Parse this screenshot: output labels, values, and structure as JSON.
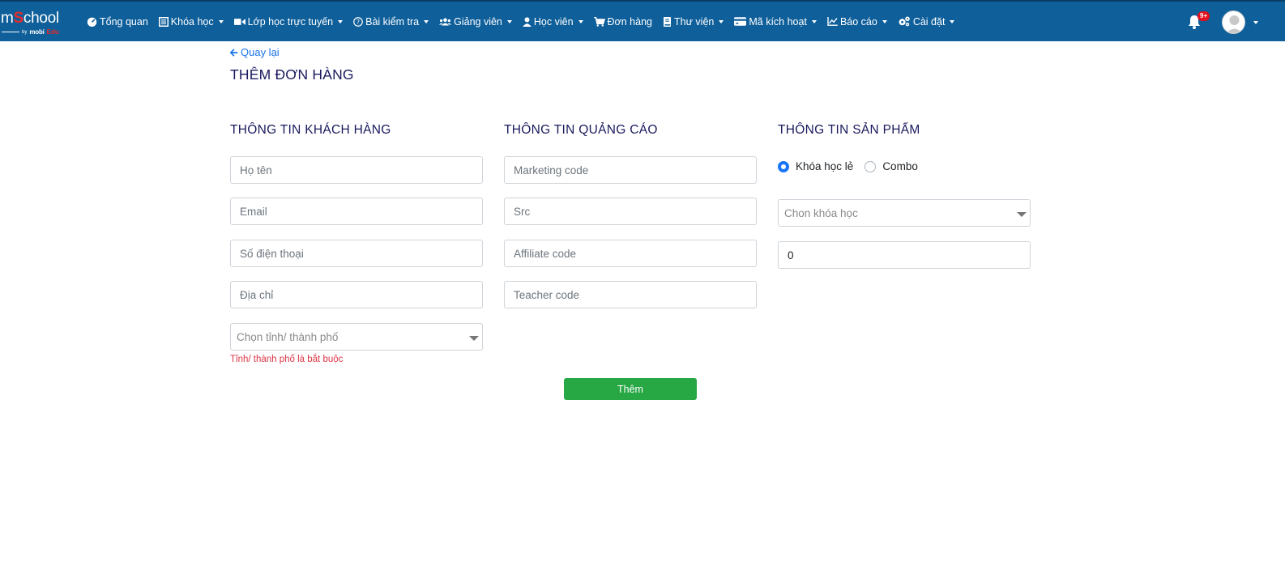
{
  "brand": {
    "name_part1": "m",
    "name_part2": "S",
    "name_part3": "chool",
    "sub_mobi": "mobi",
    "sub_edu": "Edu"
  },
  "nav": {
    "items": [
      {
        "label": "Tổng quan",
        "icon": "dashboard-icon",
        "dropdown": false
      },
      {
        "label": "Khóa học",
        "icon": "list-icon",
        "dropdown": true
      },
      {
        "label": "Lớp học trực tuyến",
        "icon": "video-icon",
        "dropdown": true
      },
      {
        "label": "Bài kiểm tra",
        "icon": "question-circle-icon",
        "dropdown": true
      },
      {
        "label": "Giảng viên",
        "icon": "users-icon",
        "dropdown": true
      },
      {
        "label": "Học viên",
        "icon": "user-icon",
        "dropdown": true
      },
      {
        "label": "Đơn hàng",
        "icon": "cart-icon",
        "dropdown": false
      },
      {
        "label": "Thư viện",
        "icon": "book-icon",
        "dropdown": true
      },
      {
        "label": "Mã kích hoạt",
        "icon": "credit-card-icon",
        "dropdown": true
      },
      {
        "label": "Báo cáo",
        "icon": "chart-line-icon",
        "dropdown": true
      },
      {
        "label": "Cài đặt",
        "icon": "gears-icon",
        "dropdown": true
      }
    ],
    "notification_badge": "9+"
  },
  "page": {
    "back_label": "Quay lại",
    "title": "THÊM ĐƠN HÀNG"
  },
  "customer": {
    "title": "THÔNG TIN KHÁCH HÀNG",
    "name_placeholder": "Họ tên",
    "email_placeholder": "Email",
    "phone_placeholder": "Số điện thoại",
    "address_placeholder": "Địa chỉ",
    "city_placeholder": "Chọn tỉnh/ thành phố",
    "city_error": "Tỉnh/ thành phố là bắt buộc"
  },
  "ads": {
    "title": "THÔNG TIN QUẢNG CÁO",
    "marketing_placeholder": "Marketing code",
    "src_placeholder": "Src",
    "affiliate_placeholder": "Affiliate code",
    "teacher_placeholder": "Teacher code"
  },
  "product": {
    "title": "THÔNG TIN SẢN PHẨM",
    "radio_single": "Khóa học lẻ",
    "radio_combo": "Combo",
    "selected": "single",
    "course_placeholder": "Chon khóa học",
    "amount_value": "0"
  },
  "submit_label": "Thêm",
  "colors": {
    "navbar": "#0e5f9a",
    "accent": "#1976f5",
    "submit": "#28a745",
    "error": "#dc3545",
    "title": "#1a1a5e"
  }
}
